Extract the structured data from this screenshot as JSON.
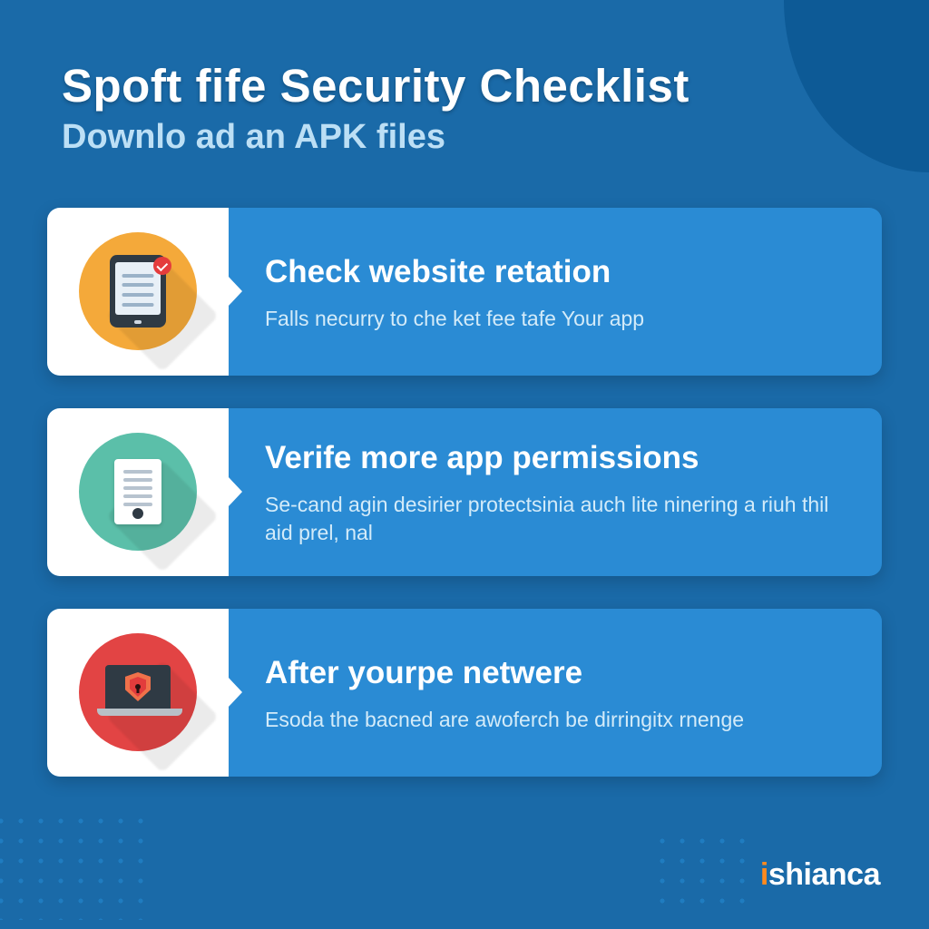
{
  "header": {
    "title": "Spoft fife Security Checklist",
    "subtitle": "Downlo ad an APK files"
  },
  "cards": [
    {
      "icon": "tablet-check-icon",
      "circle_color": "#f4a93a",
      "heading": "Check website retation",
      "text": "Falls necurry to che ket fee tafe Your app"
    },
    {
      "icon": "document-icon",
      "circle_color": "#5bbfa9",
      "heading": "Verife more app permissions",
      "text": "Se-cand agin desirier protectsinia auch lite ninering a riuh thil aid prel, nal"
    },
    {
      "icon": "laptop-shield-icon",
      "circle_color": "#e24444",
      "heading": "After yourpe netwere",
      "text": "Esoda the bacned are awoferch be dirringitx rnenge"
    }
  ],
  "brand": {
    "prefix": "i",
    "name": "shianca"
  }
}
